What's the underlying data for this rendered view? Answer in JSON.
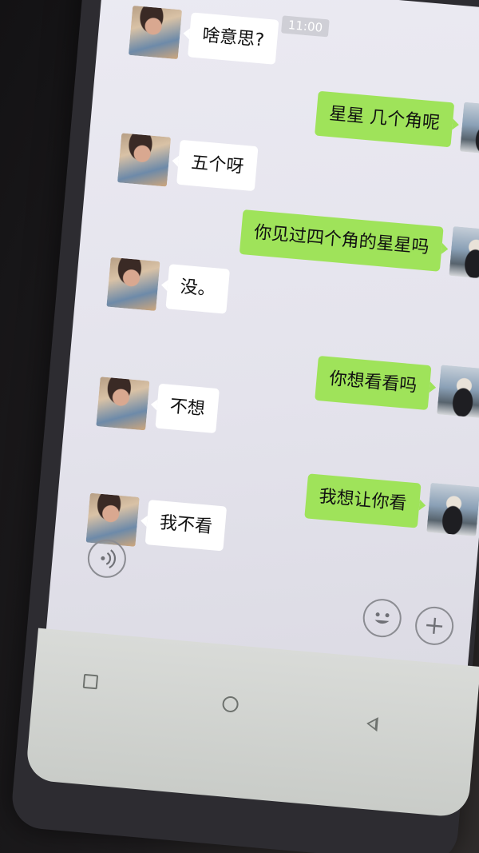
{
  "chat": {
    "timestamp": "11:00",
    "messages": [
      {
        "side": "in",
        "text": "啥意思?"
      },
      {
        "side": "out",
        "text": "星星 几个角呢"
      },
      {
        "side": "in",
        "text": "五个呀"
      },
      {
        "side": "out",
        "text": "你见过四个角的星星吗"
      },
      {
        "side": "in",
        "text": "没。"
      },
      {
        "side": "out",
        "text": "你想看看吗"
      },
      {
        "side": "in",
        "text": "不想"
      },
      {
        "side": "out",
        "text": "我想让你看"
      },
      {
        "side": "in",
        "text": "我不看"
      }
    ]
  },
  "input_bar": {
    "voice_icon": "voice-icon",
    "emoji_icon": "emoji-icon",
    "plus_icon": "plus-icon"
  },
  "colors": {
    "outgoing_bubble": "#9fe35a",
    "incoming_bubble": "#ffffff",
    "chat_background": "#e8e7ef"
  }
}
